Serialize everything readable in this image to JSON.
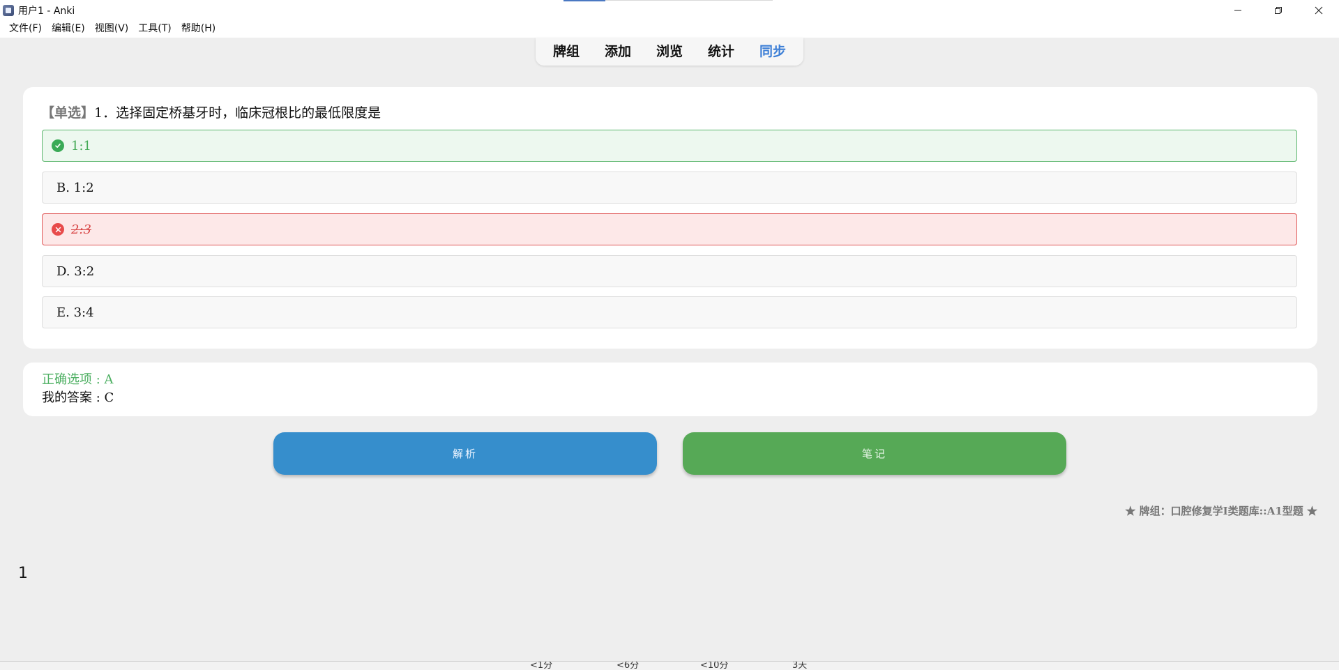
{
  "window": {
    "title": "用户1 - Anki"
  },
  "menu": [
    "文件(F)",
    "编辑(E)",
    "视图(V)",
    "工具(T)",
    "帮助(H)"
  ],
  "toolbar": {
    "items": [
      "牌组",
      "添加",
      "浏览",
      "统计",
      "同步"
    ],
    "active": "同步"
  },
  "question": {
    "tag": "【单选】",
    "text": "1．选择固定桥基牙时，临床冠根比的最低限度是"
  },
  "options": [
    {
      "text": "1:1",
      "state": "correct"
    },
    {
      "text": "B. 1:2",
      "state": "normal"
    },
    {
      "text": "2:3",
      "state": "wrong"
    },
    {
      "text": "D. 3:2",
      "state": "normal"
    },
    {
      "text": "E. 3:4",
      "state": "normal"
    }
  ],
  "answer": {
    "correct_line": "正确选项 : A",
    "mine_line": "我的答案 : C"
  },
  "buttons": {
    "analysis": "解析",
    "note": "笔记"
  },
  "deck_info": "★ 牌组：口腔修复学I类题库::A1型题 ★",
  "counter": "1",
  "bottom_bar": [
    "<1分",
    "<6分",
    "<10分",
    "3天"
  ],
  "colors": {
    "accent_blue": "#3d7fd6",
    "correct_green": "#44a955",
    "wrong_red": "#d94848",
    "analysis_btn": "#368ecc",
    "note_btn": "#56a956"
  }
}
